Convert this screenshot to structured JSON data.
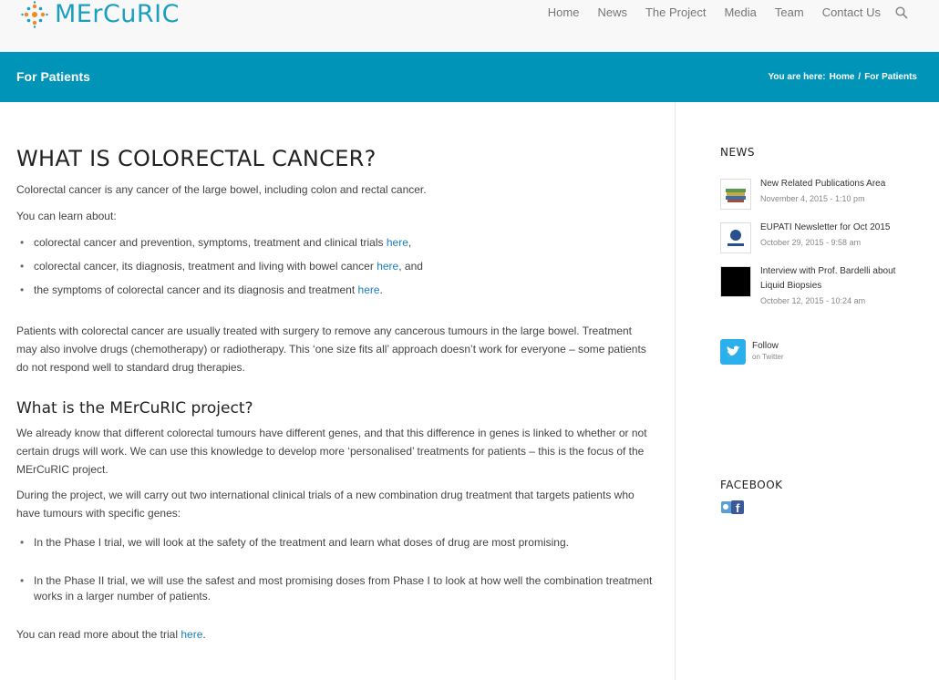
{
  "site": {
    "logo_text": "MErCuRIC",
    "nav": [
      "Home",
      "News",
      "The Project",
      "Media",
      "Team",
      "Contact Us"
    ]
  },
  "titlebar": {
    "page_title": "For Patients",
    "breadcrumb_prefix": "You are here:",
    "breadcrumb_home": "Home",
    "breadcrumb_sep": "/",
    "breadcrumb_current": "For Patients"
  },
  "main": {
    "heading": "WHAT IS COLORECTAL CANCER?",
    "intro": "Colorectal cancer is any cancer of the large bowel, including colon and rectal cancer.",
    "learn_label": "You can learn about:",
    "learn_items": [
      {
        "text": "colorectal cancer and prevention, symptoms, treatment and clinical trials ",
        "link": "here",
        "tail": ","
      },
      {
        "text": "colorectal cancer, its diagnosis, treatment and living with bowel cancer ",
        "link": "here",
        "tail": ", and"
      },
      {
        "text": "the symptoms of colorectal cancer and its diagnosis and treatment ",
        "link": "here",
        "tail": "."
      }
    ],
    "treatment_paragraph": "Patients with colorectal cancer are usually treated with surgery to remove any cancerous tumours in the large bowel. Treatment may also involve drugs (chemotherapy) or radiotherapy. This ‘one size fits all’ approach doesn’t work for everyone – some patients do not respond well to standard drug therapies.",
    "subheading": "What is the MErCuRIC project?",
    "project_paragraph": "We already know that different colorectal tumours have different genes, and that this difference in genes is linked to whether or not certain drugs will work. We can use this knowledge to develop more ‘personalised’ treatments for patients – this is the focus of the MErCuRIC project.",
    "trials_paragraph": "During the project, we will carry out two international clinical trials of a new combination drug treatment that targets patients who have tumours with specific genes:",
    "trial_items": [
      "In the Phase I trial, we will look at the safety of the treatment and learn what doses of drug are most promising.",
      "In the Phase II trial, we will use the safest and most promising doses from Phase I to look at how well the combination treatment works in a larger number of patients."
    ],
    "read_more_text": "You can read more about the trial ",
    "read_more_link": "here",
    "read_more_tail": "."
  },
  "sidebar": {
    "news_title": "NEWS",
    "news": [
      {
        "title": "New Related Publications Area",
        "date": "November 4, 2015 - 1:10 pm"
      },
      {
        "title": "EUPATI Newsletter for Oct 2015",
        "date": "October 29, 2015 - 9:58 am"
      },
      {
        "title": "Interview with Prof. Bardelli about Liquid Biopsies",
        "date": "October 12, 2015 - 10:24 am"
      }
    ],
    "follow_label": "Follow",
    "follow_sub": "on Twitter",
    "facebook_title": "FACEBOOK"
  },
  "colors": {
    "brand": "#1a9fbf",
    "titlebar": "#0094b8",
    "link": "#1a7fbf",
    "twitter": "#2bb0ec"
  }
}
